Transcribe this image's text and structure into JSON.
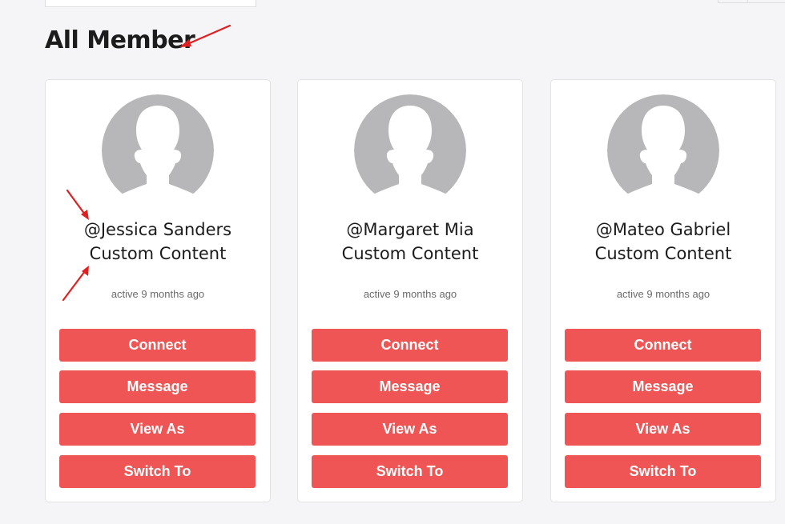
{
  "page": {
    "title": "All Member"
  },
  "theme": {
    "accent": "#ef5555",
    "avatar_color": "#b7b7b9",
    "annotation_color": "#e02020"
  },
  "members": [
    {
      "name": "@Jessica Sanders",
      "subtitle": "Custom Content",
      "activity": "active 9 months ago",
      "avatar_icon": "default-avatar-icon",
      "buttons": {
        "connect": "Connect",
        "message": "Message",
        "view_as": "View As",
        "switch_to": "Switch To"
      }
    },
    {
      "name": "@Margaret Mia",
      "subtitle": "Custom Content",
      "activity": "active 9 months ago",
      "avatar_icon": "default-avatar-icon",
      "buttons": {
        "connect": "Connect",
        "message": "Message",
        "view_as": "View As",
        "switch_to": "Switch To"
      }
    },
    {
      "name": "@Mateo Gabriel",
      "subtitle": "Custom Content",
      "activity": "active 9 months ago",
      "avatar_icon": "default-avatar-icon",
      "buttons": {
        "connect": "Connect",
        "message": "Message",
        "view_as": "View As",
        "switch_to": "Switch To"
      }
    }
  ]
}
